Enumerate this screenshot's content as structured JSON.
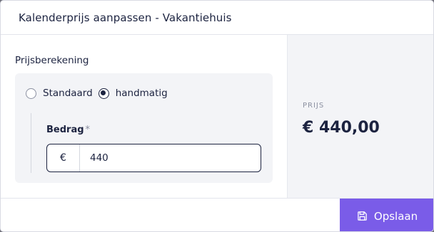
{
  "modal": {
    "title": "Kalenderprijs aanpassen - Vakantiehuis"
  },
  "pricing": {
    "section_label": "Prijsberekening",
    "options": [
      {
        "label": "Standaard",
        "selected": false
      },
      {
        "label": "handmatig",
        "selected": true
      }
    ],
    "amount_field": {
      "label": "Bedrag",
      "required_marker": "*",
      "currency_symbol": "€",
      "value": "440"
    }
  },
  "summary": {
    "caption": "PRIJS",
    "price": "€ 440,00"
  },
  "footer": {
    "save_label": "Opslaan",
    "save_icon": "floppy-disk-icon"
  },
  "colors": {
    "accent": "#7a5ce8",
    "text_primary": "#1c2340",
    "panel_bg": "#f3f4f7"
  }
}
